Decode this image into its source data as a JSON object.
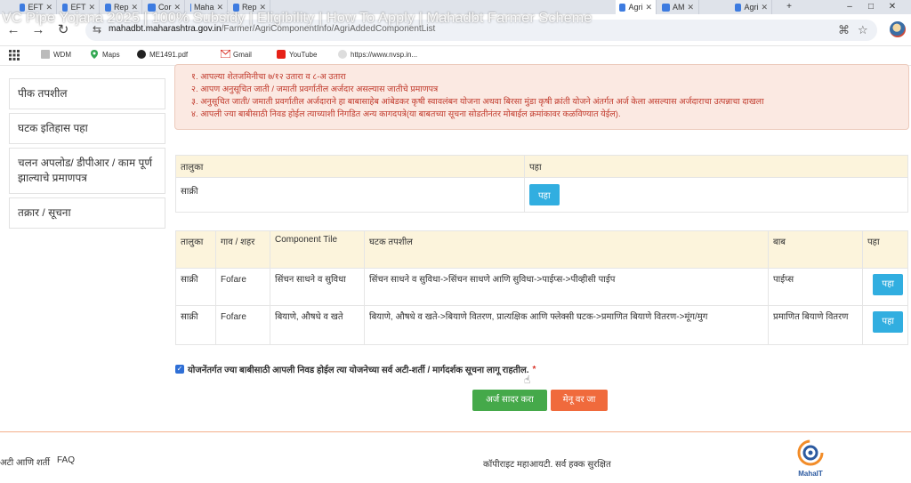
{
  "video_overlay_title": "VC Pipe Yojana 2025 | 100% Subsidy | Eligibility | How To Apply | Mahadbt Farmer Scheme",
  "browser": {
    "tabs": [
      {
        "label": "EFT"
      },
      {
        "label": "EFT"
      },
      {
        "label": "Rep"
      },
      {
        "label": "Cor"
      },
      {
        "label": "Maha"
      },
      {
        "label": "Rep"
      },
      {
        "label": "Agri",
        "active": true
      },
      {
        "label": "AM"
      },
      {
        "label": "Agri"
      }
    ],
    "url_host": "mahadbt.maharashtra.gov.in",
    "url_path": "/Farmer/AgriComponentInfo/AgriAddedComponentList",
    "bookmarks": [
      "WDM",
      "Maps",
      "ME1491.pdf",
      "Gmail",
      "YouTube",
      "https://www.nvsp.in..."
    ],
    "icons": {
      "back": "back-arrow-icon",
      "forward": "forward-arrow-icon",
      "reload": "reload-icon",
      "apps": "apps-grid-icon",
      "translate": "translate-icon",
      "star": "bookmark-star-icon"
    }
  },
  "sidebar": {
    "items": [
      {
        "label": "पीक तपशील"
      },
      {
        "label": "घटक इतिहास पहा"
      },
      {
        "label": "चलन अपलोड/ डीपीआर / काम पूर्ण झाल्याचे प्रमाणपत्र"
      },
      {
        "label": "तक्रार / सूचना"
      }
    ]
  },
  "notice": {
    "lines": [
      "१. आपल्या शेतजमिनीचा ७/१२ उतारा व ८-अ उतारा",
      "२. आपण अनुसूचित जाती / जमाती प्रवर्गातील अर्जदार असल्यास जातीचे प्रमाणपत्र",
      "३. अनुसूचित जाती/ जमाती प्रवर्गातील अर्जदाराने हा बाबासाहेब आंबेडकर कृषी स्वावलंबन योजना अथवा बिरसा मुंडा कृषी क्रांती योजने अंतर्गत अर्ज केला असल्यास अर्जदाराचा उत्पन्नाचा दाखला",
      "४. आपली ज्या बाबीसाठी निवड होईल त्याच्याशी निगडित अन्य कागदपत्रे(या बाबतच्या सूचना सोडतीनंतर मोबाईल क्रमांकावर कळविण्यात येईल)."
    ]
  },
  "taluka_table": {
    "headers": [
      "तालुका",
      "पहा"
    ],
    "rows": [
      {
        "taluka": "साक्री",
        "view_label": "पहा"
      }
    ]
  },
  "component_table": {
    "headers": [
      "तालुका",
      "गाव / शहर",
      "Component Tile",
      "घटक तपशील",
      "बाब",
      "पहा"
    ],
    "rows": [
      {
        "taluka": "साक्री",
        "village": "Fofare",
        "component": "सिंचन साधने व सुविधा",
        "detail": "सिंचन साधने व सुविधा->सिंचन साधणे आणि सुविधा->पाईप्स->पीव्हीसी पाईप",
        "item": "पाईप्स",
        "view_label": "पहा"
      },
      {
        "taluka": "साक्री",
        "village": "Fofare",
        "component": "बियाणे, औषधे व खते",
        "detail": "बियाणे, औषधे व खते->बियाणे वितरण, प्रात्यक्षिक आणि फ्लेक्सी घटक->प्रमाणित बियाणे वितरण->मूंग/मुग",
        "item": "प्रमाणित बियाणे वितरण",
        "view_label": "पहा"
      }
    ]
  },
  "agreement": {
    "text": "योजनेंतर्गत ज्या बाबीसाठी आपली निवड होईल त्या योजनेच्या सर्व अटी-शर्ती / मार्गदर्शक सूचना लागू राहतील.",
    "required_mark": "*",
    "checked": true
  },
  "actions": {
    "submit_label": "अर्ज सादर करा",
    "menu_label": "मेनू वर जा"
  },
  "footer": {
    "links": [
      "अटी आणि शर्ती",
      "FAQ"
    ],
    "copyright": "कॉपीराइट महाआयटी. सर्व हक्क सुरक्षित",
    "logo_text": "MahaIT"
  },
  "colors": {
    "view_button": "#31aee0",
    "submit_button": "#45a94a",
    "menu_button": "#f06a3c",
    "notice_text": "#c0392b",
    "table_header": "#fcf4dc"
  }
}
